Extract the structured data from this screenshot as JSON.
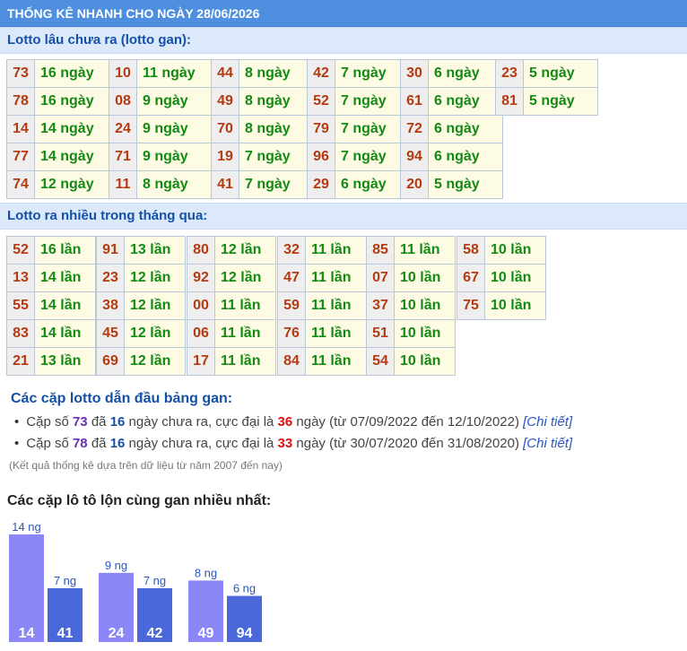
{
  "header": {
    "title": "THỐNG KÊ NHANH CHO NGÀY 28/06/2026"
  },
  "section_gan": {
    "title": "Lotto lâu chưa ra (lotto gan):"
  },
  "gan_groups": [
    [
      {
        "num": "73",
        "val": "16 ngày"
      },
      {
        "num": "78",
        "val": "16 ngày"
      },
      {
        "num": "14",
        "val": "14 ngày"
      },
      {
        "num": "77",
        "val": "14 ngày"
      },
      {
        "num": "74",
        "val": "12 ngày"
      }
    ],
    [
      {
        "num": "10",
        "val": "11 ngày"
      },
      {
        "num": "08",
        "val": "9 ngày"
      },
      {
        "num": "24",
        "val": "9 ngày"
      },
      {
        "num": "71",
        "val": "9 ngày"
      },
      {
        "num": "11",
        "val": "8 ngày"
      }
    ],
    [
      {
        "num": "44",
        "val": "8 ngày"
      },
      {
        "num": "49",
        "val": "8 ngày"
      },
      {
        "num": "70",
        "val": "8 ngày"
      },
      {
        "num": "19",
        "val": "7 ngày"
      },
      {
        "num": "41",
        "val": "7 ngày"
      }
    ],
    [
      {
        "num": "42",
        "val": "7 ngày"
      },
      {
        "num": "52",
        "val": "7 ngày"
      },
      {
        "num": "79",
        "val": "7 ngày"
      },
      {
        "num": "96",
        "val": "7 ngày"
      },
      {
        "num": "29",
        "val": "6 ngày"
      }
    ],
    [
      {
        "num": "30",
        "val": "6 ngày"
      },
      {
        "num": "61",
        "val": "6 ngày"
      },
      {
        "num": "72",
        "val": "6 ngày"
      },
      {
        "num": "94",
        "val": "6 ngày"
      },
      {
        "num": "20",
        "val": "5 ngày"
      }
    ],
    [
      {
        "num": "23",
        "val": "5 ngày"
      },
      {
        "num": "81",
        "val": "5 ngày"
      }
    ]
  ],
  "section_nhieu": {
    "title": "Lotto ra nhiều trong tháng qua:"
  },
  "nhieu_groups": [
    [
      {
        "num": "52",
        "val": "16 lần"
      },
      {
        "num": "13",
        "val": "14 lần"
      },
      {
        "num": "55",
        "val": "14 lần"
      },
      {
        "num": "83",
        "val": "14 lần"
      },
      {
        "num": "21",
        "val": "13 lần"
      }
    ],
    [
      {
        "num": "91",
        "val": "13 lần"
      },
      {
        "num": "23",
        "val": "12 lần"
      },
      {
        "num": "38",
        "val": "12 lần"
      },
      {
        "num": "45",
        "val": "12 lần"
      },
      {
        "num": "69",
        "val": "12 lần"
      }
    ],
    [
      {
        "num": "80",
        "val": "12 lần"
      },
      {
        "num": "92",
        "val": "12 lần"
      },
      {
        "num": "00",
        "val": "11 lần"
      },
      {
        "num": "06",
        "val": "11 lần"
      },
      {
        "num": "17",
        "val": "11 lần"
      }
    ],
    [
      {
        "num": "32",
        "val": "11 lần"
      },
      {
        "num": "47",
        "val": "11 lần"
      },
      {
        "num": "59",
        "val": "11 lần"
      },
      {
        "num": "76",
        "val": "11 lần"
      },
      {
        "num": "84",
        "val": "11 lần"
      }
    ],
    [
      {
        "num": "85",
        "val": "11 lần"
      },
      {
        "num": "07",
        "val": "10 lần"
      },
      {
        "num": "37",
        "val": "10 lần"
      },
      {
        "num": "51",
        "val": "10 lần"
      },
      {
        "num": "54",
        "val": "10 lần"
      }
    ],
    [
      {
        "num": "58",
        "val": "10 lần"
      },
      {
        "num": "67",
        "val": "10 lần"
      },
      {
        "num": "75",
        "val": "10 lần"
      }
    ]
  ],
  "pairs": {
    "title": "Các cặp lotto dẫn đầu bảng gan:",
    "items": [
      {
        "p1": "Cặp số ",
        "num": "73",
        "p2": " đã ",
        "days": "16",
        "p3": " ngày chưa ra, cực đại là ",
        "max": "36",
        "p4": " ngày (từ 07/09/2022 đến 12/10/2022) ",
        "link": "[Chi tiết]"
      },
      {
        "p1": "Cặp số ",
        "num": "78",
        "p2": " đã ",
        "days": "16",
        "p3": " ngày chưa ra, cực đại là ",
        "max": "33",
        "p4": " ngày (từ 30/07/2020 đến 31/08/2020) ",
        "link": "[Chi tiết]"
      }
    ],
    "note": "(Kết quả thống kê dựa trên dữ liệu từ năm 2007 đến nay)"
  },
  "chart_data": {
    "type": "bar",
    "title": "Các cặp lô tô lộn cùng gan nhiều nhất:",
    "categories": [
      "14",
      "41",
      "24",
      "42",
      "49",
      "94"
    ],
    "values": [
      14,
      7,
      9,
      7,
      8,
      6
    ],
    "value_labels": [
      "14 ng",
      "7 ng",
      "9 ng",
      "7 ng",
      "8 ng",
      "6 ng"
    ],
    "ylim": [
      0,
      14
    ],
    "grid": false,
    "colors": {
      "first": "#8b87f7",
      "second": "#4a68d9",
      "label": "#2e56b8",
      "category_text": "#ffffff"
    }
  }
}
